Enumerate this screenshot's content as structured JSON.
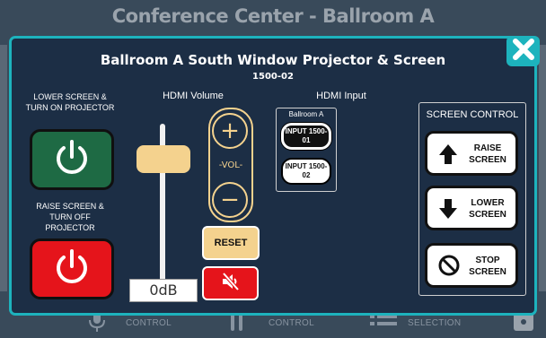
{
  "background": {
    "title": "Conference Center - Ballroom A",
    "footer": [
      {
        "label": "CONTROL",
        "icon": "microphone-icon"
      },
      {
        "label": "CONTROL",
        "icon": "mixer-icon"
      },
      {
        "label": "SELECTION",
        "icon": "list-icon"
      }
    ]
  },
  "modal": {
    "title": "Ballroom A South Window Projector & Screen",
    "subtitle": "1500-02",
    "close_icon": "close-icon"
  },
  "power": {
    "on_label": "LOWER SCREEN & TURN ON PROJECTOR",
    "off_label": "RAISE SCREEN & TURN OFF PROJECTOR",
    "on_color": "#1e6a44",
    "off_color": "#e5141b"
  },
  "volume": {
    "heading": "HDMI Volume",
    "level_display": "0dB",
    "vol_label": "-VOL-",
    "up_symbol": "+",
    "down_symbol": "−",
    "reset_label": "RESET",
    "mute_icon": "speaker-mute-icon",
    "slider_level_fraction": 0.85
  },
  "hdmi_input": {
    "heading": "HDMI Input",
    "group_label": "Ballroom A",
    "inputs": [
      {
        "label": "INPUT 1500-01",
        "selected": true
      },
      {
        "label": "INPUT 1500-02",
        "selected": false
      }
    ]
  },
  "screen_control": {
    "heading": "SCREEN CONTROL",
    "buttons": [
      {
        "label": "RAISE SCREEN",
        "icon": "arrow-up-icon"
      },
      {
        "label": "LOWER SCREEN",
        "icon": "arrow-down-icon"
      },
      {
        "label": "STOP SCREEN",
        "icon": "stop-icon"
      }
    ]
  },
  "colors": {
    "accent": "#1db3bd",
    "modal_bg": "#1c2e45",
    "volume_accent": "#f4d28e"
  }
}
